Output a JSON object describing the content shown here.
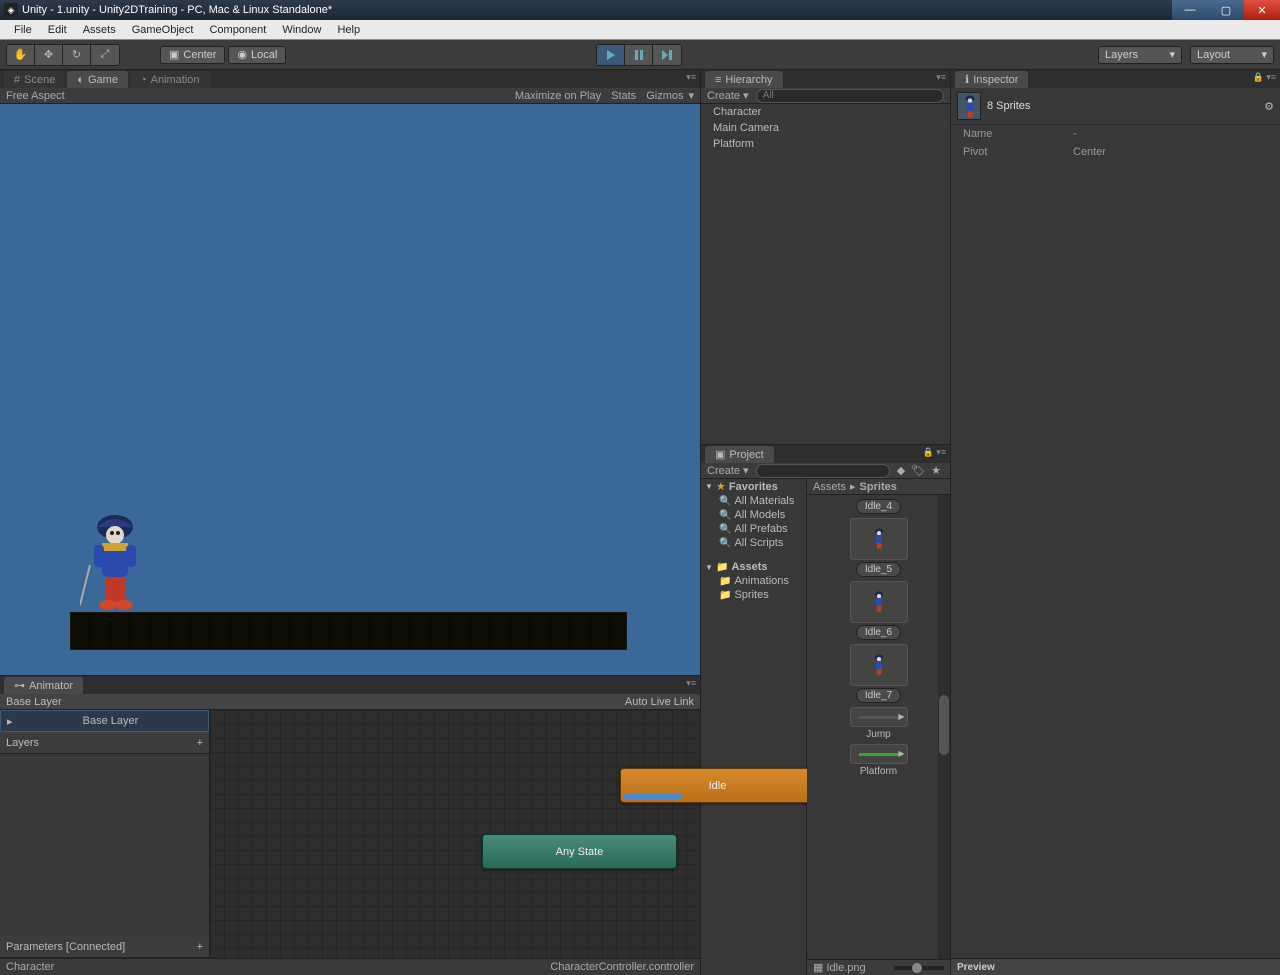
{
  "window": {
    "title": "Unity - 1.unity - Unity2DTraining - PC, Mac & Linux Standalone*"
  },
  "menu": [
    "File",
    "Edit",
    "Assets",
    "GameObject",
    "Component",
    "Window",
    "Help"
  ],
  "toolbar": {
    "pivot": "Center",
    "handle": "Local",
    "layers": "Layers",
    "layout": "Layout"
  },
  "tabs": {
    "scene": "Scene",
    "game": "Game",
    "animation": "Animation",
    "animator": "Animator",
    "hierarchy": "Hierarchy",
    "project": "Project",
    "inspector": "Inspector"
  },
  "gamebar": {
    "aspect": "Free Aspect",
    "maxplay": "Maximize on Play",
    "stats": "Stats",
    "gizmos": "Gizmos"
  },
  "hierarchy": {
    "create": "Create",
    "search_placeholder": "All",
    "items": [
      "Character",
      "Main Camera",
      "Platform"
    ]
  },
  "project": {
    "create": "Create",
    "breadcrumb": [
      "Assets",
      "Sprites"
    ],
    "favorites_label": "Favorites",
    "favorites": [
      "All Materials",
      "All Models",
      "All Prefabs",
      "All Scripts"
    ],
    "assets_label": "Assets",
    "folders": [
      "Animations",
      "Sprites"
    ],
    "grid": [
      {
        "label": "Idle_4",
        "type": "sprite-label"
      },
      {
        "label": "Idle_5",
        "type": "sprite"
      },
      {
        "label": "Idle_6",
        "type": "sprite"
      },
      {
        "label": "Idle_7",
        "type": "sprite"
      },
      {
        "label": "Jump",
        "type": "anim"
      },
      {
        "label": "Platform",
        "type": "anim"
      }
    ],
    "status": "Idle.png"
  },
  "inspector": {
    "title": "8 Sprites",
    "rows": [
      {
        "label": "Name",
        "value": "-"
      },
      {
        "label": "Pivot",
        "value": "Center"
      }
    ],
    "preview": "Preview"
  },
  "animator": {
    "breadcrumb": "Base Layer",
    "autolive": "Auto Live Link",
    "layer_selected": "Base Layer",
    "layers_label": "Layers",
    "parameters": "Parameters [Connected]",
    "states": {
      "idle": "Idle",
      "anystate": "Any State"
    },
    "status_left": "Character",
    "status_right": "CharacterController.controller"
  }
}
